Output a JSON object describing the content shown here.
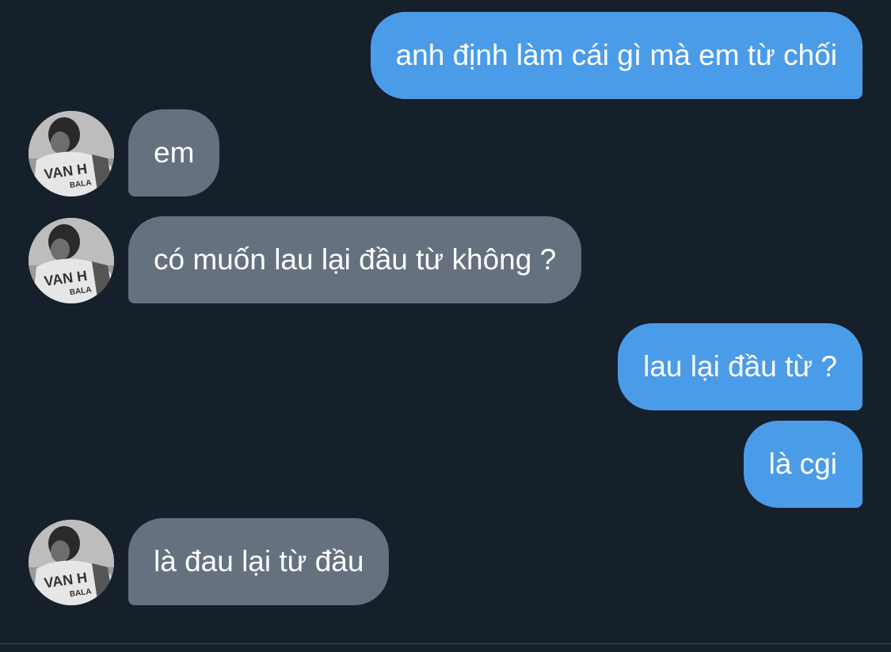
{
  "conversation": {
    "messages": [
      {
        "direction": "outgoing",
        "text": "anh định làm cái gì mà em từ chối"
      },
      {
        "direction": "incoming",
        "text": "em",
        "avatar_icon": "contact-avatar"
      },
      {
        "direction": "incoming",
        "text": "có muốn lau lại đầu từ không ?",
        "avatar_icon": "contact-avatar"
      },
      {
        "direction": "outgoing",
        "text": "lau lại đầu từ ?"
      },
      {
        "direction": "outgoing",
        "text": "là cgi"
      },
      {
        "direction": "incoming",
        "text": "là đau lại từ đầu",
        "avatar_icon": "contact-avatar"
      }
    ],
    "avatar_shirt_text": "VAN H",
    "avatar_shirt_subtext": "BALA"
  },
  "colors": {
    "background": "#15202b",
    "outgoing_bubble": "#4b9ce8",
    "incoming_bubble": "#66717f",
    "text": "#ffffff",
    "divider": "#38444d"
  }
}
